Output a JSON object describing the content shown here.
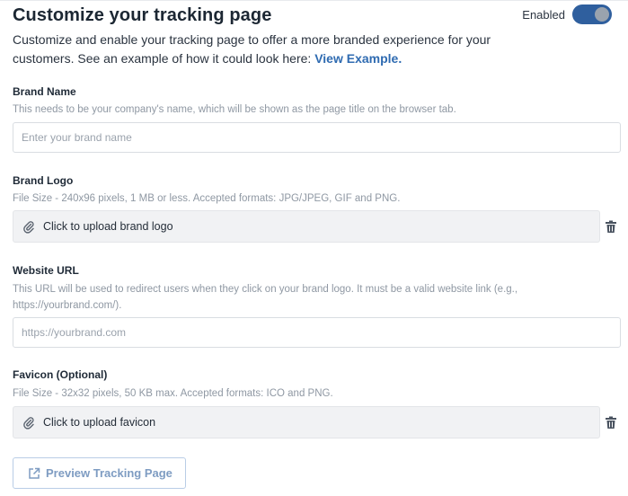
{
  "header": {
    "title": "Customize your tracking page",
    "toggle_label": "Enabled",
    "toggle_on": true,
    "accent_color": "#2f5f9e"
  },
  "intro": {
    "text": "Customize and enable your tracking page to offer a more branded experience for your customers. See an example of how it could look here: ",
    "link_text": "View Example."
  },
  "brand_name": {
    "label": "Brand Name",
    "help": "This needs to be your company's name, which will be shown as the page title on the browser tab.",
    "value": "",
    "placeholder": "Enter your brand name"
  },
  "brand_logo": {
    "label": "Brand Logo",
    "help": "File Size - 240x96 pixels, 1 MB or less. Accepted formats: JPG/JPEG, GIF and PNG.",
    "upload_label": "Click to upload brand logo",
    "icons": [
      "paperclip-icon",
      "trash-icon"
    ]
  },
  "website_url": {
    "label": "Website URL",
    "help": "This URL will be used to redirect users when they click on your brand logo. It must be a valid website link (e.g., https://yourbrand.com/).",
    "value": "",
    "placeholder": "https://yourbrand.com"
  },
  "favicon": {
    "label": "Favicon (Optional)",
    "help": "File Size - 32x32 pixels, 50 KB max. Accepted formats: ICO and PNG.",
    "upload_label": "Click to upload favicon",
    "icons": [
      "paperclip-icon",
      "trash-icon"
    ]
  },
  "preview_button": {
    "label": "Preview Tracking Page",
    "icon": "external-link-icon"
  }
}
